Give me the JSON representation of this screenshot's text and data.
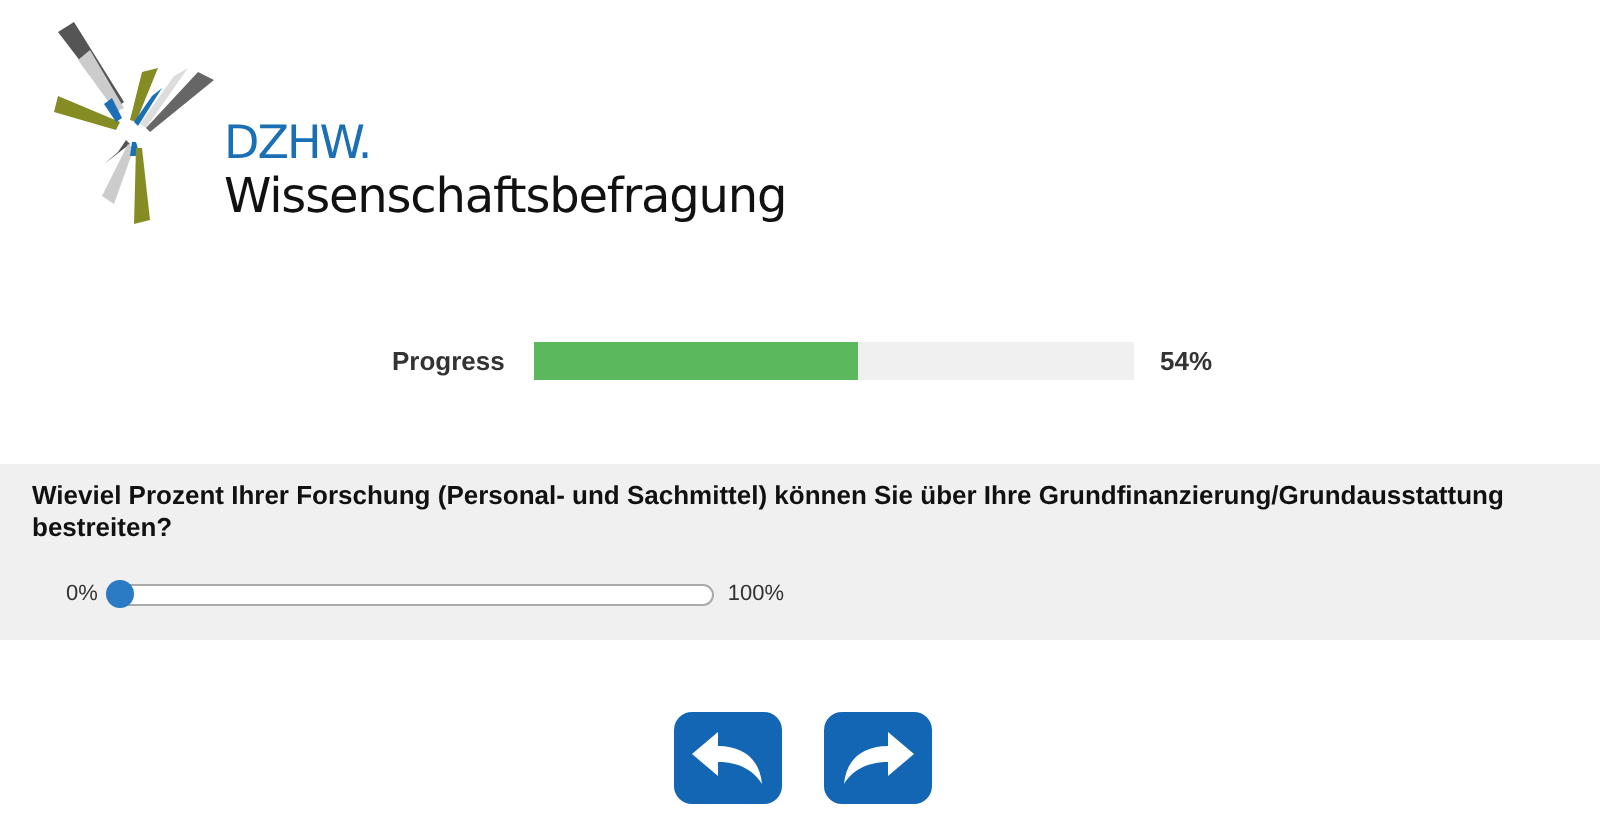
{
  "logo": {
    "acronym": "DZHW.",
    "name": "Wissenschaftsbefragung"
  },
  "progress": {
    "label": "Progress",
    "level": 0.54,
    "reading": "54%"
  },
  "question": {
    "text": "Wieviel Prozent Ihrer Forschung (Personal- und Sachmittel) können Sie über Ihre Grundfinanzierung/Grundausstattung bestreiten?",
    "slider": {
      "min_label": "0%",
      "max_label": "100%",
      "level": 0
    }
  },
  "buttons": [
    {
      "kind": "back"
    },
    {
      "kind": "next"
    }
  ]
}
